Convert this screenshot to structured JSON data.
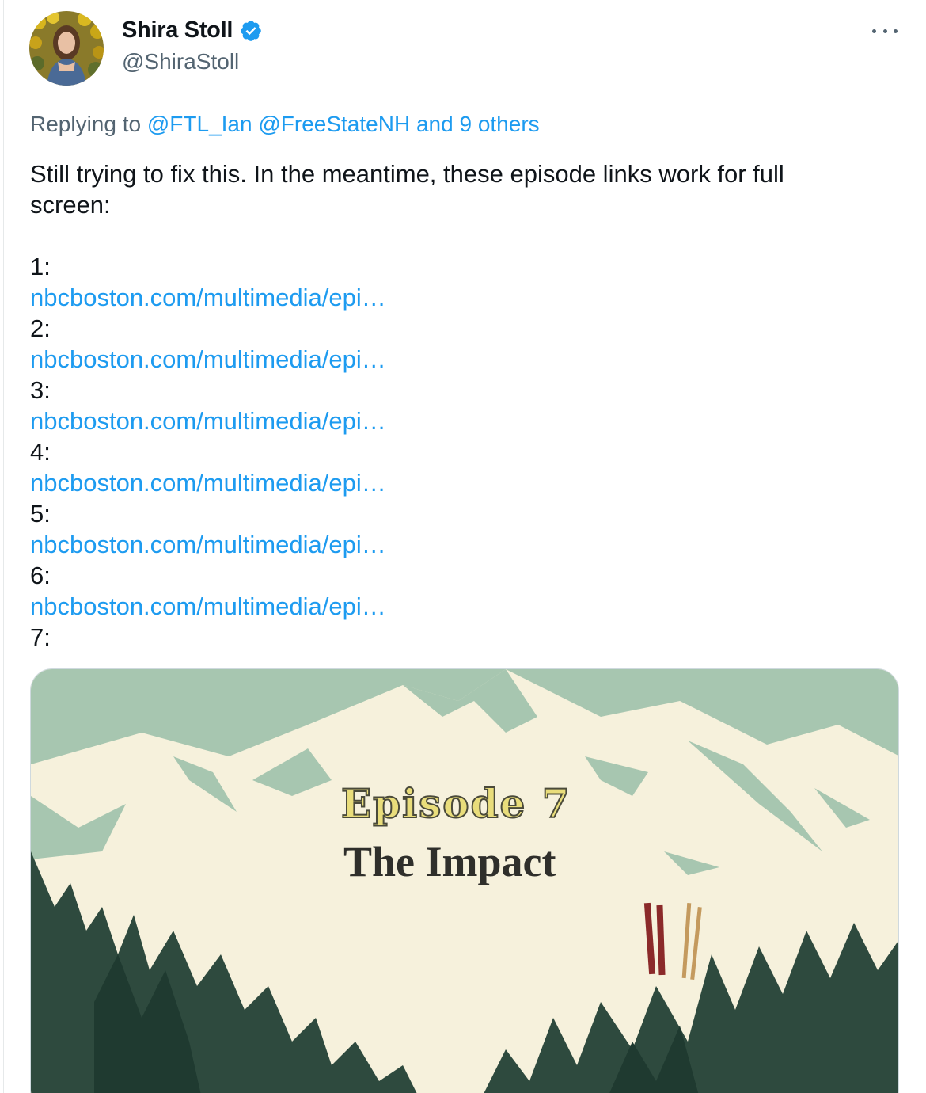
{
  "author": {
    "display_name": "Shira Stoll",
    "handle": "@ShiraStoll",
    "verified_icon": "verified-badge-icon"
  },
  "more_icon": "more-options-icon",
  "reply": {
    "prefix": "Replying to",
    "mention1": "@FTL_Ian",
    "mention2": "@FreeStateNH",
    "others": "and 9 others"
  },
  "tweet": {
    "text": "Still trying to fix this. In the meantime, these episode links work for full",
    "text_line2": "screen:",
    "episodes": [
      {
        "label": "1:",
        "link": "nbcboston.com/multimedia/epi…"
      },
      {
        "label": "2:",
        "link": "nbcboston.com/multimedia/epi…"
      },
      {
        "label": "3:",
        "link": "nbcboston.com/multimedia/epi…"
      },
      {
        "label": "4:",
        "link": "nbcboston.com/multimedia/epi…"
      },
      {
        "label": "5:",
        "link": "nbcboston.com/multimedia/epi…"
      },
      {
        "label": "6:",
        "link": "nbcboston.com/multimedia/epi…"
      }
    ],
    "last_label": "7:"
  },
  "media": {
    "episode_title": "Episode 7",
    "episode_subtitle": "The Impact"
  },
  "colors": {
    "link": "#1d9bf0",
    "secondary_text": "#536471",
    "verified": "#1d9bf0",
    "mountain": "#a4c3ac",
    "tree": "#2e4a3e"
  }
}
